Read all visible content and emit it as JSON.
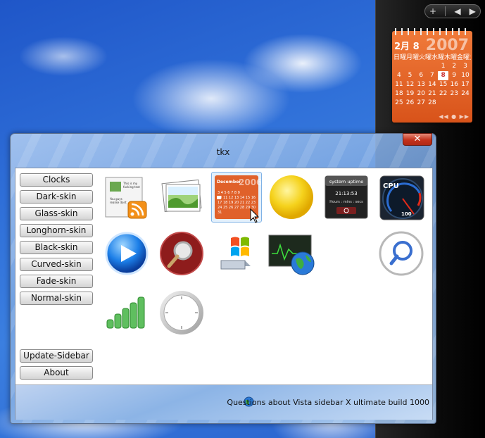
{
  "sidebar": {
    "controls": [
      "+",
      "◀",
      "▶"
    ],
    "calendar": {
      "month_label": "2月 8",
      "year": "2007",
      "weekday_header": "日曜月曜火曜水曜木曜金曜土曜",
      "weeks": [
        [
          "",
          "",
          "",
          "",
          "1",
          "2",
          "3"
        ],
        [
          "4",
          "5",
          "6",
          "7",
          "8",
          "9",
          "10"
        ],
        [
          "11",
          "12",
          "13",
          "14",
          "15",
          "16",
          "17"
        ],
        [
          "18",
          "19",
          "20",
          "21",
          "22",
          "23",
          "24"
        ],
        [
          "25",
          "26",
          "27",
          "28",
          "",
          "",
          ""
        ]
      ],
      "today": "8",
      "nav": "◀◀ ● ▶▶"
    }
  },
  "window": {
    "title": "tkx",
    "close_label": "✕"
  },
  "menu": {
    "skins": [
      "Clocks",
      "Dark-skin",
      "Glass-skin",
      "Longhorn-skin",
      "Black-skin",
      "Curved-skin",
      "Fade-skin",
      "Normal-skin"
    ],
    "bottom": [
      "Update-Sidebar",
      "About"
    ]
  },
  "gadgets": {
    "feed_text": "This is my fucking text don't tip me tout it ne fuck of! You guys realise don't know it but you are gay fucking gay",
    "calendar_tile": {
      "month": "December",
      "year": "2006"
    },
    "uptime": {
      "title": "system uptime",
      "time": "21:13:53",
      "units": "Hours : mins : secs"
    },
    "cpu": {
      "label": "CPU",
      "value": "100"
    }
  },
  "status": {
    "text": "Questions about Vista sidebar X ultimate build 1000"
  },
  "colors": {
    "accent_orange": "#e0612a",
    "sky_blue": "#2f6fd8",
    "sun_yellow": "#f5d21c"
  }
}
